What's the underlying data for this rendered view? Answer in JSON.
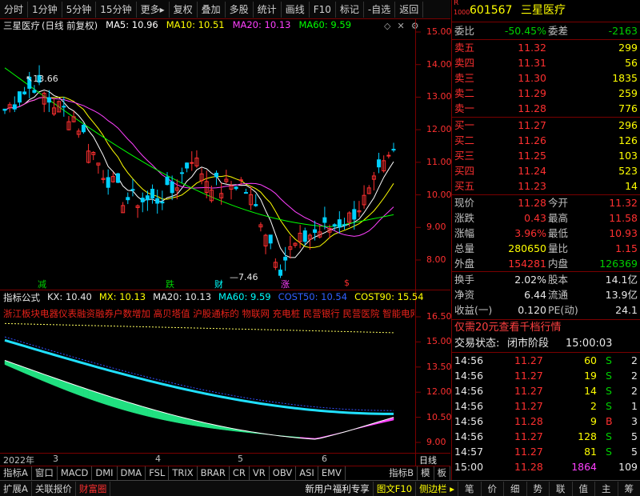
{
  "toolbar": {
    "period_tabs": [
      "分时",
      "1分钟",
      "5分钟",
      "15分钟",
      "更多"
    ],
    "more_arrow": "▸",
    "tools": [
      "复权",
      "叠加",
      "多股",
      "统计",
      "画线",
      "F10",
      "标记",
      "-自选",
      "返回"
    ]
  },
  "chart_header": {
    "name": "三星医疗",
    "mode": "(日线 前复权)",
    "ma5": "MA5: 10.96",
    "ma10": "MA10: 10.51",
    "ma20": "MA20: 10.13",
    "ma60": "MA60: 9.59",
    "colors": {
      "ma5": "#ffffff",
      "ma10": "#ffff00",
      "ma20": "#ff40ff",
      "ma60": "#00ff00"
    }
  },
  "price_axis": [
    "15.00",
    "14.00",
    "13.00",
    "12.00",
    "11.00",
    "10.00",
    "9.00",
    "8.00"
  ],
  "annotations": {
    "high": "13.66",
    "low": "7.46"
  },
  "signals": [
    {
      "text": "减",
      "color": "#00d000"
    },
    {
      "text": "跌",
      "color": "#00d000"
    },
    {
      "text": "财",
      "color": "#00ffff"
    },
    {
      "text": "涨",
      "color": "#ff40ff"
    },
    {
      "text": "$",
      "color": "#ff3030"
    }
  ],
  "indicator_header": {
    "title": "指标公式",
    "kx": "KX: 10.40",
    "mx": "MX: 10.13",
    "ma20": "MA20: 10.13",
    "ma60": "MA60: 9.59",
    "cost50": "COST50: 10.54",
    "cost90": "COST90: 15.54"
  },
  "scroll_text": "浙江板块电器仪表融资融券户数增加 高贝塔值 沪股通标的 物联网 充电桩 民营银行 民营医院 智能电网",
  "indicator_axis": [
    "16.50",
    "15.00",
    "13.50",
    "12.00",
    "10.50",
    "9.00"
  ],
  "date_axis": [
    "2022年",
    "3",
    "4",
    "5",
    "6"
  ],
  "date_axis_right": "日线",
  "indicator_tabs": [
    "指标A",
    "窗口",
    "MACD",
    "DMI",
    "DMA",
    "FSL",
    "TRIX",
    "BRAR",
    "CR",
    "VR",
    "OBV",
    "ASI",
    "EMV"
  ],
  "indicator_tabs_right": [
    "指标B",
    "模",
    "板"
  ],
  "bottom_tabs": [
    "扩展A",
    "关联报价",
    "财富圈"
  ],
  "bottom_right": [
    "新用户福利专享",
    "图文F10",
    "侧边栏 ▸",
    "笔",
    "价",
    "细",
    "势",
    "联",
    "值",
    "主",
    "筹"
  ],
  "quote": {
    "code": "601567",
    "name": "三星医疗",
    "badge_r": "R",
    "badge_num": "1000",
    "weibi_label": "委比",
    "weibi": "-50.45%",
    "weicha_label": "委差",
    "weicha": "-2163",
    "sells": [
      {
        "label": "卖五",
        "price": "11.32",
        "vol": "299"
      },
      {
        "label": "卖四",
        "price": "11.31",
        "vol": "56"
      },
      {
        "label": "卖三",
        "price": "11.30",
        "vol": "1835"
      },
      {
        "label": "卖二",
        "price": "11.29",
        "vol": "259"
      },
      {
        "label": "卖一",
        "price": "11.28",
        "vol": "776"
      }
    ],
    "buys": [
      {
        "label": "买一",
        "price": "11.27",
        "vol": "296"
      },
      {
        "label": "买二",
        "price": "11.26",
        "vol": "126"
      },
      {
        "label": "买三",
        "price": "11.25",
        "vol": "103"
      },
      {
        "label": "买四",
        "price": "11.24",
        "vol": "523"
      },
      {
        "label": "买五",
        "price": "11.23",
        "vol": "14"
      }
    ],
    "stats": [
      {
        "l1": "现价",
        "v1": "11.28",
        "c1": "red",
        "l2": "今开",
        "v2": "11.32",
        "c2": "red"
      },
      {
        "l1": "涨跌",
        "v1": "0.43",
        "c1": "red",
        "l2": "最高",
        "v2": "11.58",
        "c2": "red"
      },
      {
        "l1": "涨幅",
        "v1": "3.96%",
        "c1": "red",
        "l2": "最低",
        "v2": "10.93",
        "c2": "red"
      },
      {
        "l1": "总量",
        "v1": "280650",
        "c1": "yellow",
        "l2": "量比",
        "v2": "1.15",
        "c2": "red"
      },
      {
        "l1": "外盘",
        "v1": "154281",
        "c1": "red",
        "l2": "内盘",
        "v2": "126369",
        "c2": "green"
      }
    ],
    "stats2": [
      {
        "l1": "换手",
        "v1": "2.02%",
        "l2": "股本",
        "v2": "14.1亿"
      },
      {
        "l1": "净资",
        "v1": "6.44",
        "l2": "流通",
        "v2": "13.9亿"
      },
      {
        "l1": "收益(一)",
        "v1": "0.120",
        "l2": "PE(动)",
        "v2": "24.1"
      }
    ],
    "promo": "仅需20元查看千档行情",
    "status_label": "交易状态:",
    "status": "闭市阶段",
    "status_time": "15:00:03"
  },
  "ticks": [
    {
      "time": "14:56",
      "price": "11.27",
      "vol": "60",
      "flag": "S",
      "n": "2",
      "vc": "yellow",
      "fc": "green"
    },
    {
      "time": "14:56",
      "price": "11.27",
      "vol": "19",
      "flag": "S",
      "n": "2",
      "vc": "yellow",
      "fc": "green"
    },
    {
      "time": "14:56",
      "price": "11.27",
      "vol": "14",
      "flag": "S",
      "n": "2",
      "vc": "yellow",
      "fc": "green"
    },
    {
      "time": "14:56",
      "price": "11.27",
      "vol": "2",
      "flag": "S",
      "n": "1",
      "vc": "yellow",
      "fc": "green"
    },
    {
      "time": "14:56",
      "price": "11.28",
      "vol": "9",
      "flag": "B",
      "n": "3",
      "vc": "yellow",
      "fc": "red"
    },
    {
      "time": "14:56",
      "price": "11.27",
      "vol": "128",
      "flag": "S",
      "n": "5",
      "vc": "yellow",
      "fc": "green"
    },
    {
      "time": "14:57",
      "price": "11.27",
      "vol": "81",
      "flag": "S",
      "n": "5",
      "vc": "yellow",
      "fc": "green"
    },
    {
      "time": "15:00",
      "price": "11.28",
      "vol": "1864",
      "flag": "",
      "n": "109",
      "vc": "mag",
      "fc": "green"
    }
  ]
}
